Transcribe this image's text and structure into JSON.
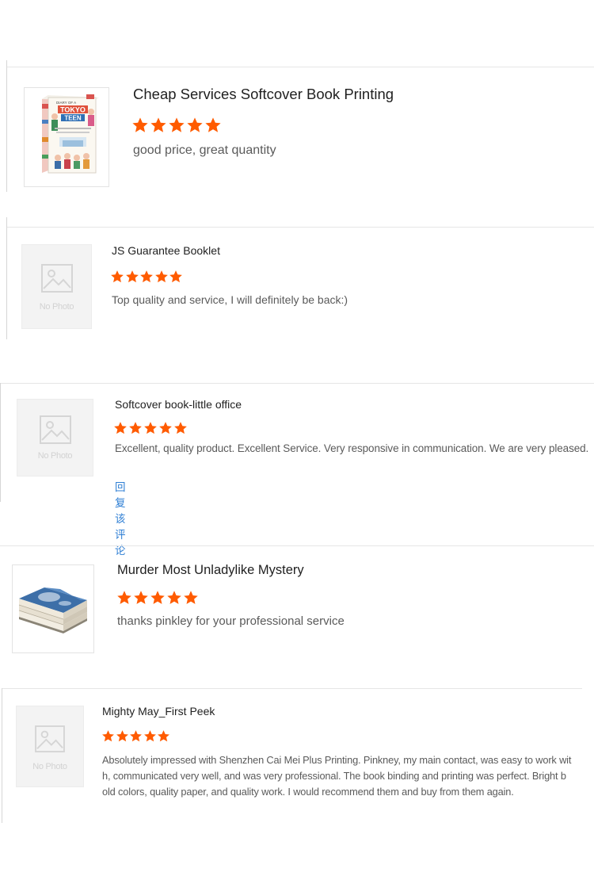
{
  "accent_color": "#ff5b00",
  "link_color": "#2f7fd4",
  "star_icon": "star-icon",
  "reviews": [
    {
      "title": "Cheap Services Softcover Book Printing",
      "rating": 5,
      "rating_max": 5,
      "comment": "good price, great quantity",
      "thumbnail": "book-box-cover-image",
      "cover_text": [
        "DIARY OF A",
        "TOKYO",
        "TEEN"
      ]
    },
    {
      "title": "JS Guarantee Booklet",
      "rating": 5,
      "rating_max": 5,
      "comment": "Top quality and service, I will definitely be back:)",
      "thumbnail": "no-photo-placeholder",
      "no_photo_text": "No Photo"
    },
    {
      "title": "Softcover book-little office",
      "rating": 5,
      "rating_max": 5,
      "comment": "Excellent, quality product. Excellent Service. Very responsive in communication. We are very pleased.",
      "thumbnail": "no-photo-placeholder",
      "no_photo_text": "No Photo",
      "reply_link": "回复该评论"
    },
    {
      "title": "Murder Most Unladylike Mystery",
      "rating": 5,
      "rating_max": 5,
      "comment": "thanks pinkley for your professional service",
      "thumbnail": "book-stack-image"
    },
    {
      "title": "Mighty May_First Peek",
      "rating": 5,
      "rating_max": 5,
      "comment_lines": [
        "Absolutely impressed with Shenzhen Cai Mei Plus Printing. Pinkney, my main contact, was easy to work wit",
        "h, communicated very well, and was very professional. The book binding and printing was perfect. Bright b",
        "old colors, quality paper, and quality work. I would recommend them and buy from them again."
      ],
      "thumbnail": "no-photo-placeholder",
      "no_photo_text": "No Photo"
    }
  ]
}
